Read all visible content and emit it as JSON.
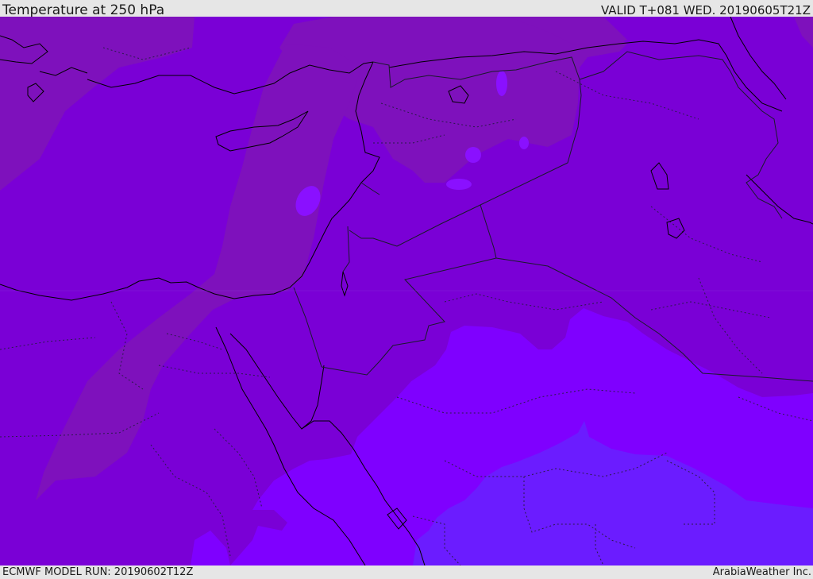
{
  "header": {
    "title": "Temperature at 250 hPa",
    "valid": "VALID T+081 WED. 20190605T21Z"
  },
  "footer": {
    "model_run": "ECMWF MODEL RUN: 20190602T12Z",
    "credit": "ArabiaWeather Inc."
  },
  "colors": {
    "base_field": "#7a00d6",
    "warm_band": "#7e11bc",
    "cool_field": "#7f00ff",
    "coldest_field": "#6b1cff",
    "coastline": "#000000",
    "border": "#1a1a2a"
  }
}
